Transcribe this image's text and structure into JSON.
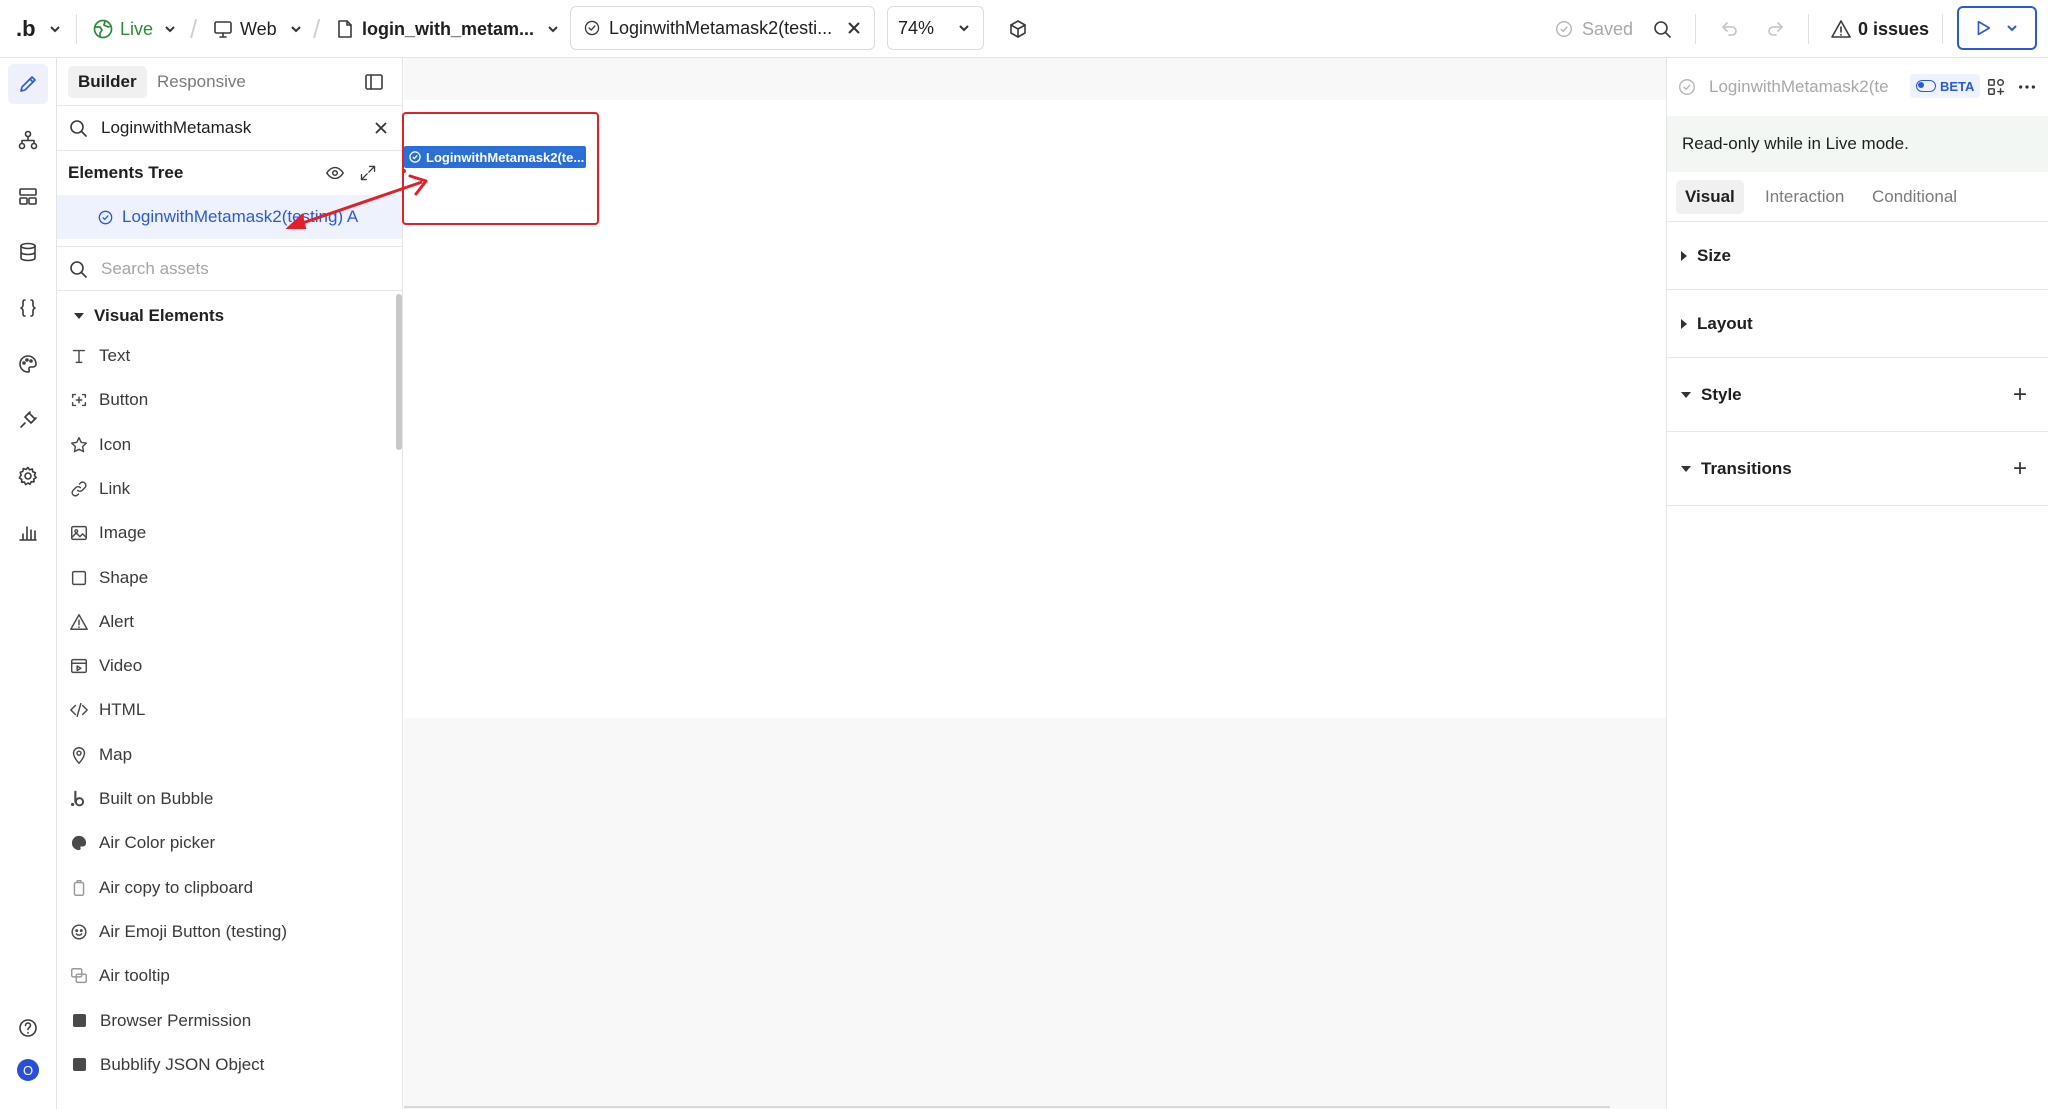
{
  "topbar": {
    "logo": ".b",
    "status": "Live",
    "platform": "Web",
    "page_name": "login_with_metam...",
    "tab_name": "LoginwithMetamask2(testi...",
    "zoom": "74%",
    "saved_label": "Saved",
    "issues_label": "0 issues"
  },
  "left_panel": {
    "tabs": [
      "Builder",
      "Responsive"
    ],
    "search_value": "LoginwithMetamask",
    "tree_title": "Elements Tree",
    "tree_item": "LoginwithMetamask2(testing) A",
    "assets_placeholder": "Search assets",
    "section_title": "Visual Elements",
    "elements": [
      {
        "label": "Text",
        "icon": "text-icon"
      },
      {
        "label": "Button",
        "icon": "button-icon"
      },
      {
        "label": "Icon",
        "icon": "star-icon"
      },
      {
        "label": "Link",
        "icon": "link-icon"
      },
      {
        "label": "Image",
        "icon": "image-icon"
      },
      {
        "label": "Shape",
        "icon": "square-icon"
      },
      {
        "label": "Alert",
        "icon": "alert-icon"
      },
      {
        "label": "Video",
        "icon": "video-icon"
      },
      {
        "label": "HTML",
        "icon": "code-icon"
      },
      {
        "label": "Map",
        "icon": "map-pin-icon"
      },
      {
        "label": "Built on Bubble",
        "icon": "bubble-logo-icon"
      },
      {
        "label": "Air Color picker",
        "icon": "palette-icon"
      },
      {
        "label": "Air copy to clipboard",
        "icon": "clipboard-icon"
      },
      {
        "label": "Air Emoji Button (testing)",
        "icon": "emoji-icon"
      },
      {
        "label": "Air tooltip",
        "icon": "tooltip-icon"
      },
      {
        "label": "Browser Permission",
        "icon": "plugin-square-icon"
      },
      {
        "label": "Bubblify JSON Object",
        "icon": "plugin-square-icon"
      }
    ]
  },
  "canvas": {
    "selected_element_label": "LoginwithMetamask2(te..."
  },
  "right_panel": {
    "title": "LoginwithMetamask2(te",
    "badge": "BETA",
    "notice": "Read-only while in Live mode.",
    "tabs": [
      "Visual",
      "Interaction",
      "Conditional"
    ],
    "sections": [
      {
        "label": "Size",
        "expanded": false,
        "addable": false
      },
      {
        "label": "Layout",
        "expanded": false,
        "addable": false
      },
      {
        "label": "Style",
        "expanded": true,
        "addable": true
      },
      {
        "label": "Transitions",
        "expanded": true,
        "addable": true
      }
    ]
  },
  "rail": {
    "bottom_avatar": "O"
  },
  "colors": {
    "accent": "#2a5ad7",
    "live_green": "#2e8b3a",
    "highlight_red": "#e2202a",
    "selected_blue": "#2a6fd6"
  }
}
